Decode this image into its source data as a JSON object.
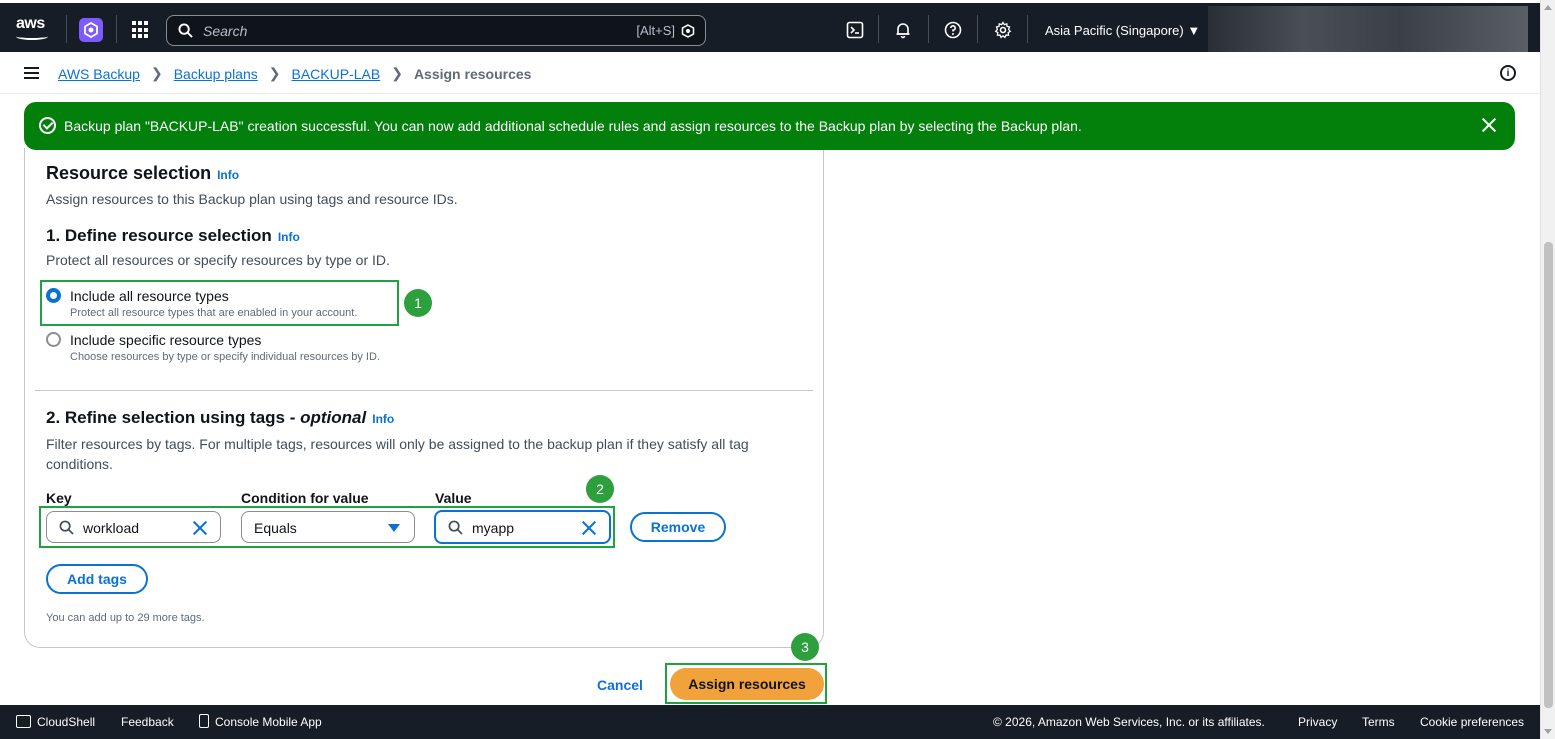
{
  "topnav": {
    "logo": "aws",
    "search_placeholder": "Search",
    "search_shortcut": "[Alt+S]",
    "region": "Asia Pacific (Singapore) ▼"
  },
  "breadcrumbs": {
    "items": [
      "AWS Backup",
      "Backup plans",
      "BACKUP-LAB"
    ],
    "current": "Assign resources"
  },
  "flash": {
    "message": "Backup plan \"BACKUP-LAB\" creation successful. You can now add additional schedule rules and assign resources to the Backup plan by selecting the Backup plan."
  },
  "resource_selection": {
    "title": "Resource selection",
    "info": "Info",
    "description": "Assign resources to this Backup plan using tags and resource IDs.",
    "define": {
      "title": "1. Define resource selection",
      "info": "Info",
      "description": "Protect all resources or specify resources by type or ID.",
      "options": [
        {
          "label": "Include all resource types",
          "description": "Protect all resource types that are enabled in your account.",
          "selected": true
        },
        {
          "label": "Include specific resource types",
          "description": "Choose resources by type or specify individual resources by ID.",
          "selected": false
        }
      ]
    },
    "refine": {
      "title": "2. Refine selection using tags - ",
      "title_optional": "optional",
      "info": "Info",
      "description": "Filter resources by tags. For multiple tags, resources will only be assigned to the backup plan if they satisfy all tag conditions.",
      "key_label": "Key",
      "condition_label": "Condition for value",
      "value_label": "Value",
      "key_value": "workload",
      "condition_value": "Equals",
      "value_value": "myapp",
      "remove_label": "Remove",
      "add_tags_label": "Add tags",
      "hint": "You can add up to 29 more tags."
    }
  },
  "annotations": [
    "1",
    "2",
    "3"
  ],
  "actions": {
    "cancel": "Cancel",
    "assign": "Assign resources"
  },
  "footer": {
    "cloudshell": "CloudShell",
    "feedback": "Feedback",
    "mobile_app": "Console Mobile App",
    "copyright": "© 2026, Amazon Web Services, Inc. or its affiliates.",
    "privacy": "Privacy",
    "terms": "Terms",
    "cookies": "Cookie preferences"
  },
  "colors": {
    "nav_bg": "#161d26",
    "link": "#0972d3",
    "success": "#037f0c",
    "primary_button": "#f1a23a",
    "annotation": "#1fa340"
  }
}
